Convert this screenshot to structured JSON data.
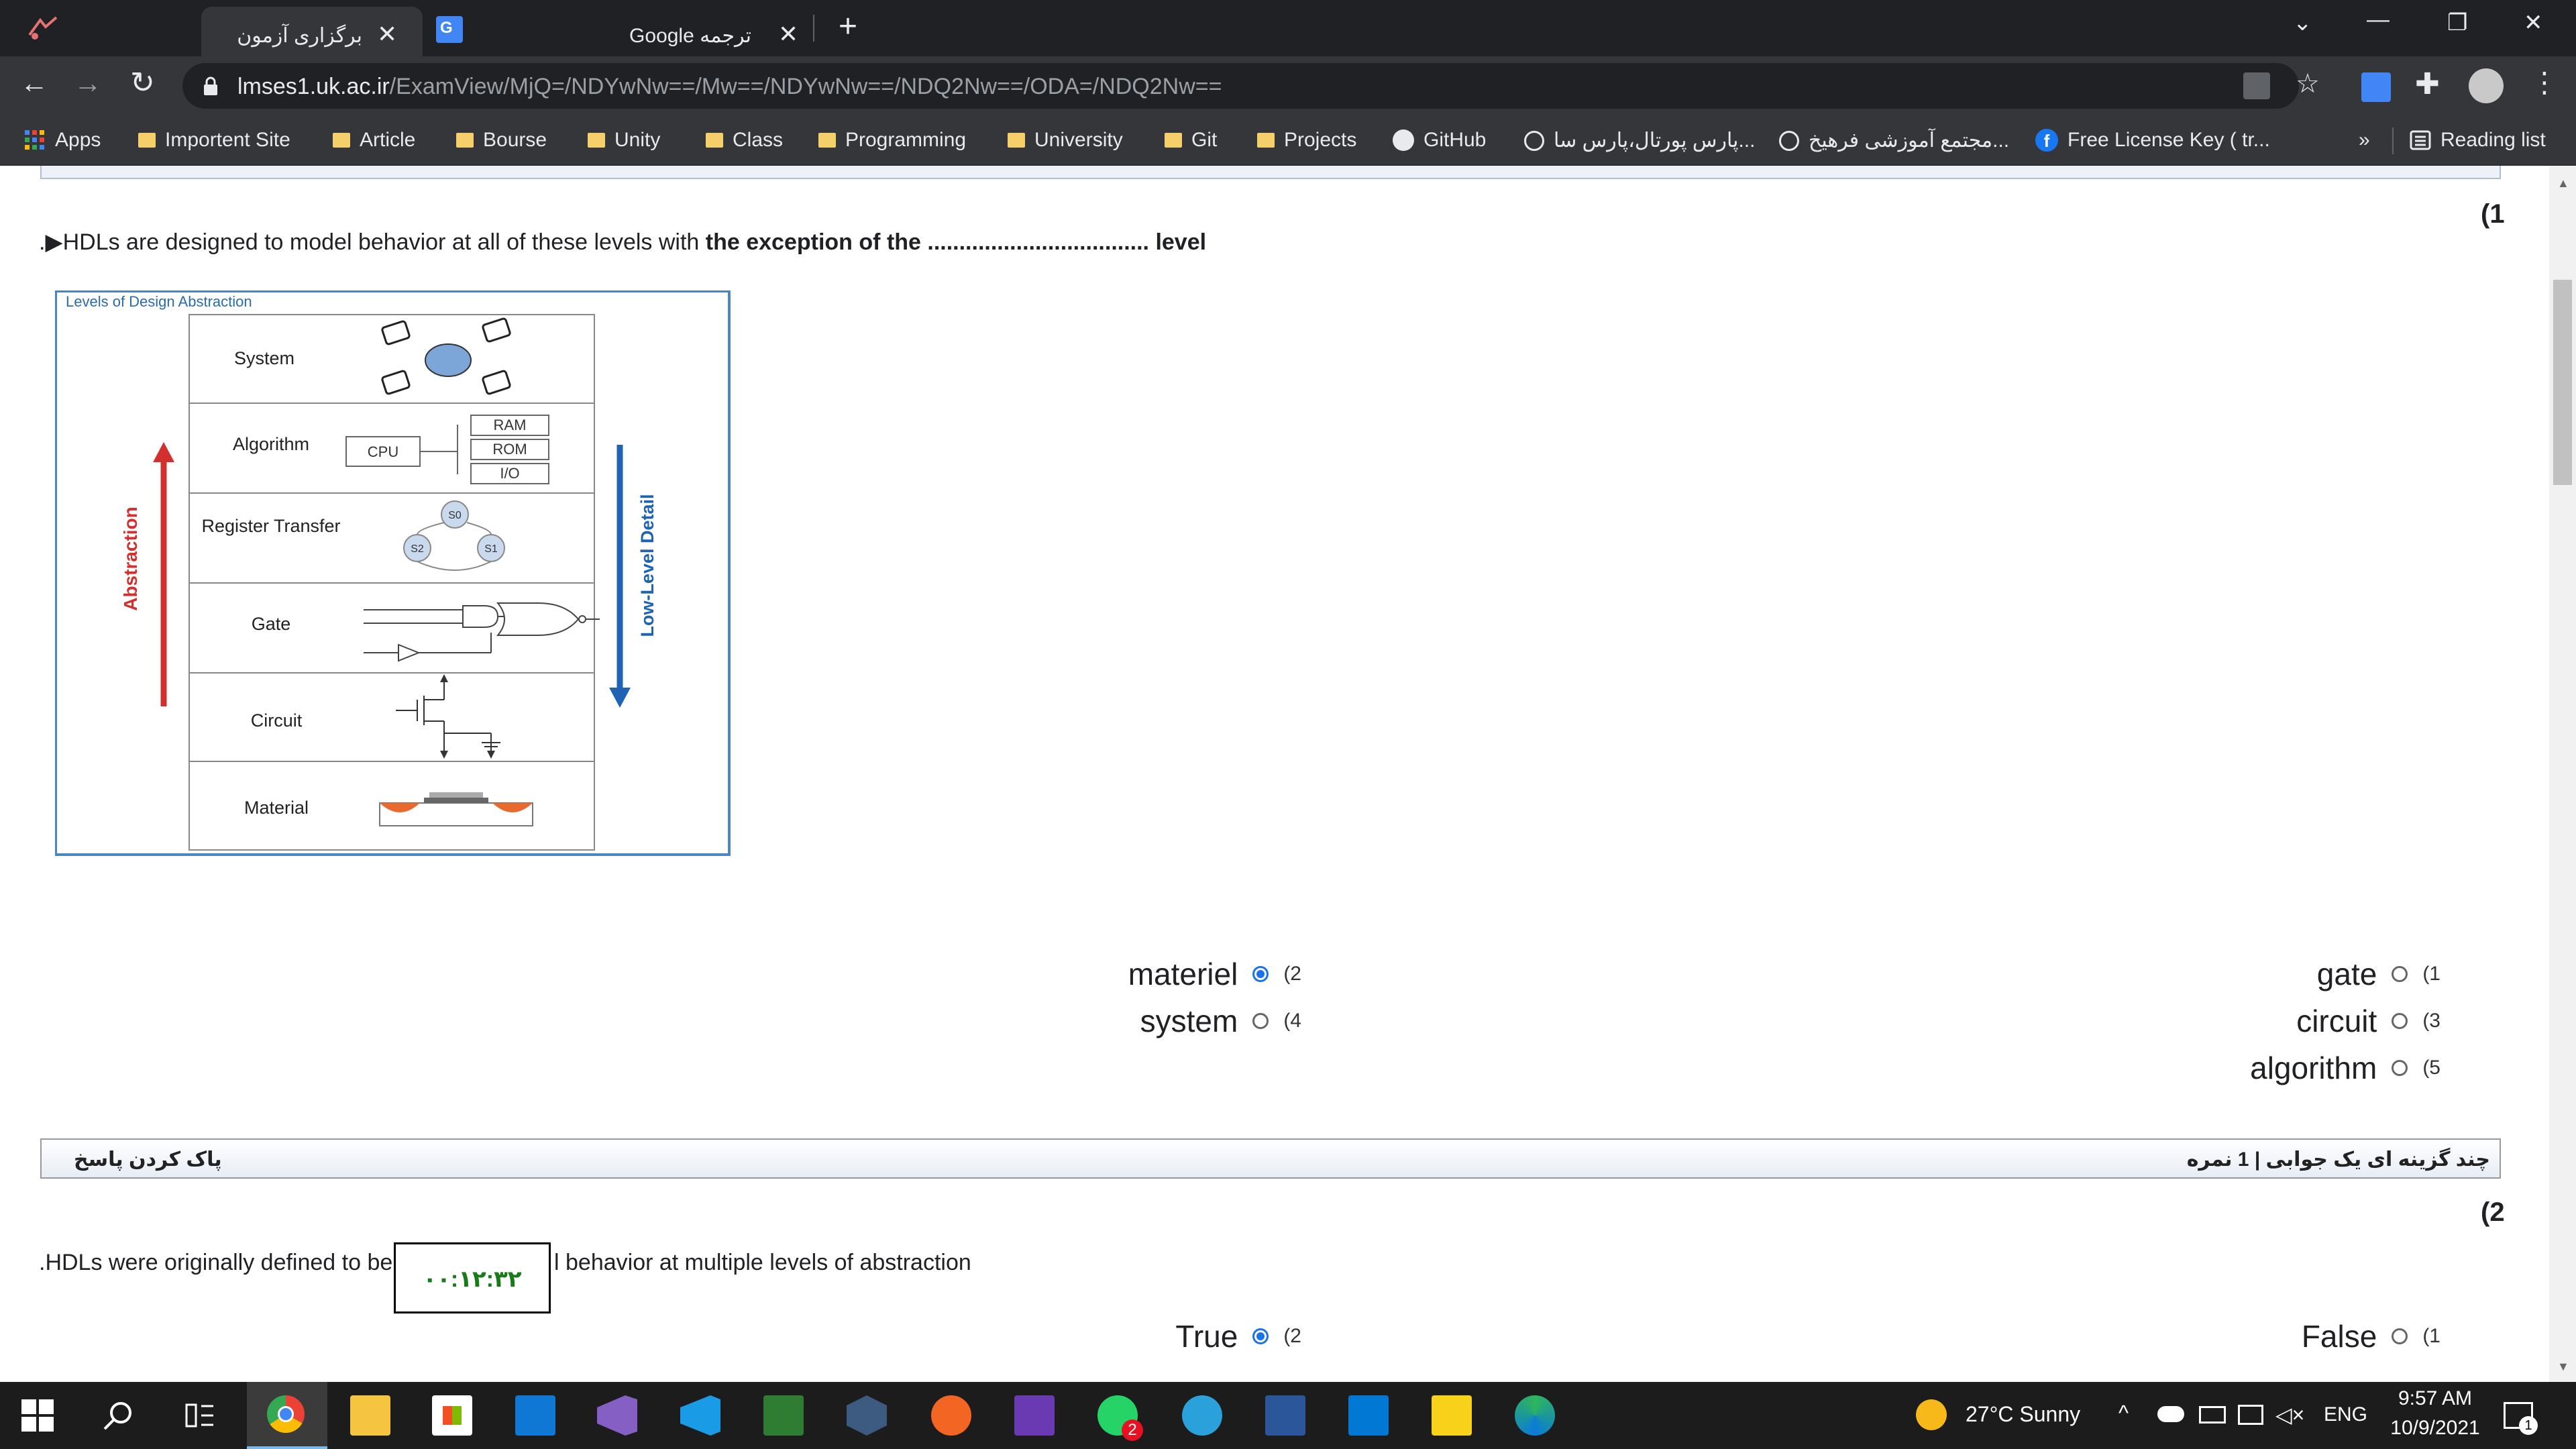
{
  "browser": {
    "tabs": [
      {
        "title": "برگزاری آزمون",
        "active": true
      },
      {
        "title": "Google ترجمه",
        "active": false
      }
    ],
    "new_tab": "+",
    "url_host": "lmses1.uk.ac.ir",
    "url_path": "/ExamView/MjQ=/NDYwNw==/Mw==/NDYwNw==/NDQ2Nw==/ODA=/NDQ2Nw==",
    "bookmarks": [
      "Apps",
      "Importent Site",
      "Article",
      "Bourse",
      "Unity",
      "Class",
      "Programming",
      "University",
      "Git",
      "Projects",
      "GitHub",
      "پارس پورتال،پارس سا...",
      "مجتمع آموزشی فرهیخ...",
      "Free License Key ( tr..."
    ],
    "bookmarks_overflow": "»",
    "reading_list": "Reading list"
  },
  "question1": {
    "number": "(1",
    "text_prefix": ".▶HDLs are designed to model behavior at all of these levels with ",
    "text_bold": "the exception of the ................................... level",
    "diagram": {
      "title": "Levels of Design Abstraction",
      "levels": [
        "System",
        "Algorithm",
        "Register Transfer",
        "Gate",
        "Circuit",
        "Material"
      ],
      "left_arrow": "Abstraction",
      "right_arrow": "Low-Level Detail",
      "cpu": "CPU",
      "mem": [
        "RAM",
        "ROM",
        "I/O"
      ],
      "states": [
        "S0",
        "S1",
        "S2"
      ]
    },
    "options": [
      {
        "num": "(1",
        "label": "gate",
        "selected": false
      },
      {
        "num": "(2",
        "label": "materiel",
        "selected": true
      },
      {
        "num": "(3",
        "label": "circuit",
        "selected": false
      },
      {
        "num": "(4",
        "label": "system",
        "selected": false
      },
      {
        "num": "(5",
        "label": "algorithm",
        "selected": false
      }
    ],
    "clear": "پاک کردن پاسخ",
    "meta": "چند گزینه ای یک جوابی | 1 نمره"
  },
  "question2": {
    "number": "(2",
    "text_start": ".HDLs were originally defined to be",
    "text_end": "l behavior at multiple levels of abstraction",
    "options": [
      {
        "num": "(1",
        "label": "False",
        "selected": false
      },
      {
        "num": "(2",
        "label": "True",
        "selected": true
      }
    ]
  },
  "timer": "۰۰:۱۲:۳۲",
  "taskbar": {
    "whatsapp_badge": "2",
    "weather": "27°C  Sunny",
    "lang": "ENG",
    "time": "9:57 AM",
    "date": "10/9/2021",
    "notifications": "1"
  },
  "colors": {
    "accent": "#1a73e8",
    "chrome_dark": "#202124",
    "chrome_toolbar": "#35363a",
    "timer_text": "#1a7a1a"
  }
}
